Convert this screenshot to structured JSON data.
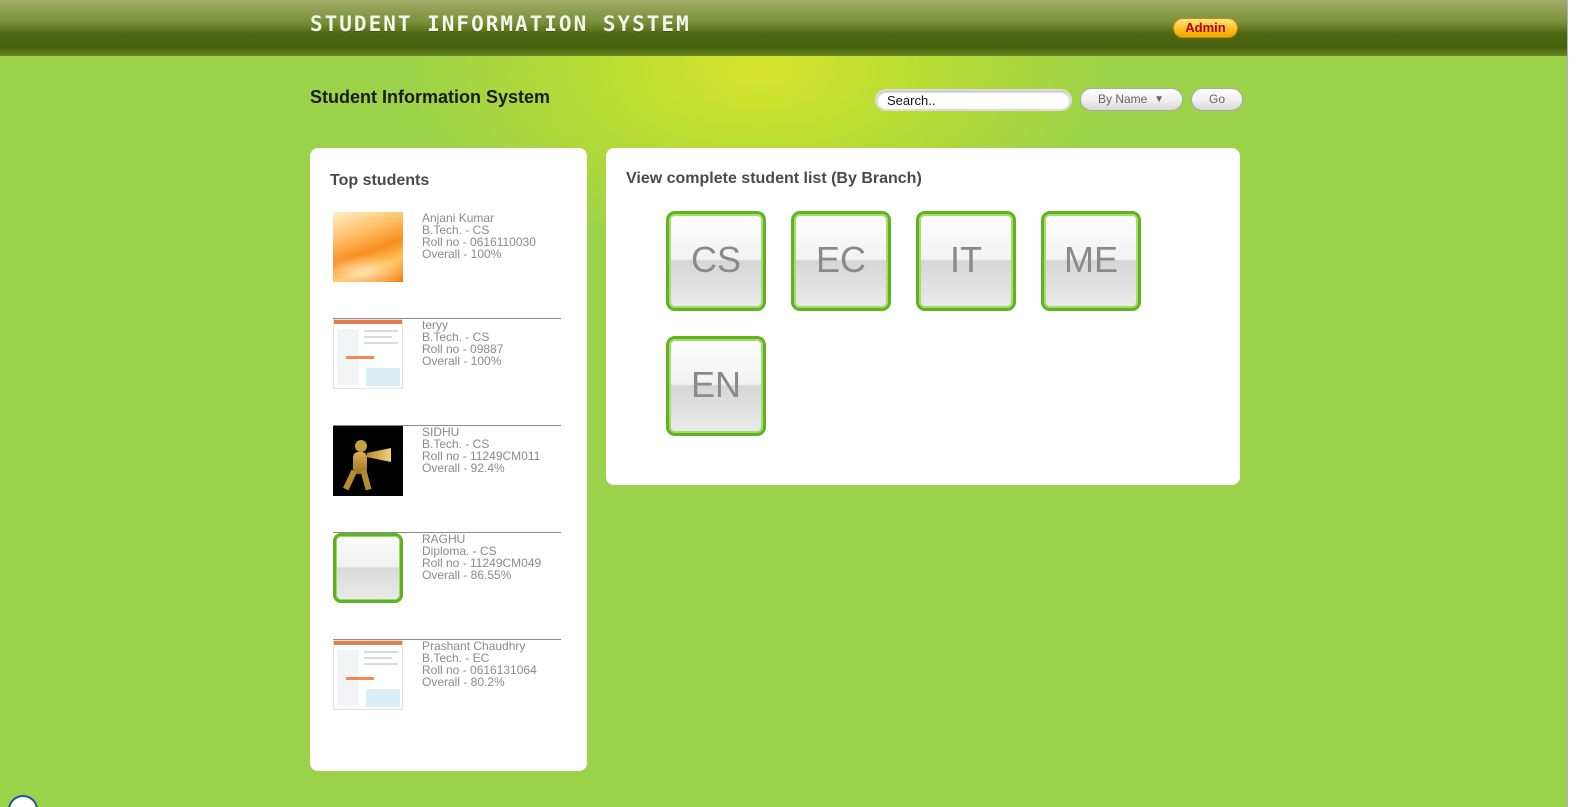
{
  "header": {
    "app_title": "Student Information System",
    "admin_label": "Admin"
  },
  "page": {
    "heading": "Student Information System"
  },
  "search": {
    "value": "Search..",
    "filter_selected": "By Name",
    "go_label": "Go"
  },
  "top_students": {
    "title": "Top students",
    "items": [
      {
        "name": "Anjani Kumar",
        "course": "B.Tech. - CS",
        "roll": "Roll no - 0616110030",
        "overall": "Overall - 100%"
      },
      {
        "name": "teryy",
        "course": "B.Tech. - CS",
        "roll": "Roll no - 09887",
        "overall": "Overall - 100%"
      },
      {
        "name": "SIDHU",
        "course": "B.Tech. - CS",
        "roll": "Roll no - 11249CM011",
        "overall": "Overall - 92.4%"
      },
      {
        "name": "RAGHU",
        "course": "Diploma. - CS",
        "roll": "Roll no - 11249CM049",
        "overall": "Overall - 86.55%"
      },
      {
        "name": "Prashant Chaudhry",
        "course": "B.Tech. - EC",
        "roll": "Roll no - 0616131064",
        "overall": "Overall - 80.2%"
      }
    ]
  },
  "branches": {
    "title": "View complete student list (By Branch)",
    "items": [
      "CS",
      "EC",
      "IT",
      "ME",
      "EN"
    ]
  },
  "colors": {
    "background": "#9ad24a",
    "header_dark": "#4f6810",
    "tile_border": "#5fb41d",
    "admin_bg": "#ffc21b",
    "admin_text": "#b50000"
  }
}
